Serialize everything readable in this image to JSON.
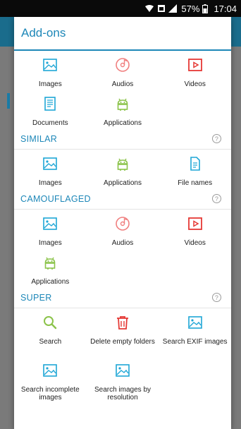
{
  "status_bar": {
    "battery": "57%",
    "time": "17:04"
  },
  "dialog": {
    "title": "Add-ons",
    "top_items": [
      {
        "label": "Images",
        "icon": "image-icon"
      },
      {
        "label": "Audios",
        "icon": "audio-icon"
      },
      {
        "label": "Videos",
        "icon": "video-icon"
      },
      {
        "label": "Documents",
        "icon": "document-icon"
      },
      {
        "label": "Applications",
        "icon": "android-icon"
      }
    ],
    "sections": [
      {
        "title": "SIMILAR",
        "items": [
          {
            "label": "Images",
            "icon": "image-icon"
          },
          {
            "label": "Applications",
            "icon": "android-icon"
          },
          {
            "label": "File names",
            "icon": "file-icon"
          }
        ]
      },
      {
        "title": "CAMOUFLAGED",
        "items": [
          {
            "label": "Images",
            "icon": "image-icon"
          },
          {
            "label": "Audios",
            "icon": "audio-icon"
          },
          {
            "label": "Videos",
            "icon": "video-icon"
          },
          {
            "label": "Applications",
            "icon": "android-icon"
          }
        ]
      },
      {
        "title": "SUPER",
        "items": [
          {
            "label": "Search",
            "icon": "search-icon"
          },
          {
            "label": "Delete empty folders",
            "icon": "trash-icon"
          },
          {
            "label": "Search EXIF images",
            "icon": "image-icon"
          },
          {
            "label": "Search incomplete images",
            "icon": "image-icon"
          },
          {
            "label": "Search images by resolution",
            "icon": "image-icon"
          }
        ]
      }
    ]
  },
  "colors": {
    "accent": "#1d87b8",
    "image_icon": "#1ea6d6",
    "audio_icon": "#f08080",
    "video_icon": "#e53935",
    "android_icon": "#8bc34a",
    "search_icon": "#8bc34a",
    "trash_icon": "#e53935"
  }
}
